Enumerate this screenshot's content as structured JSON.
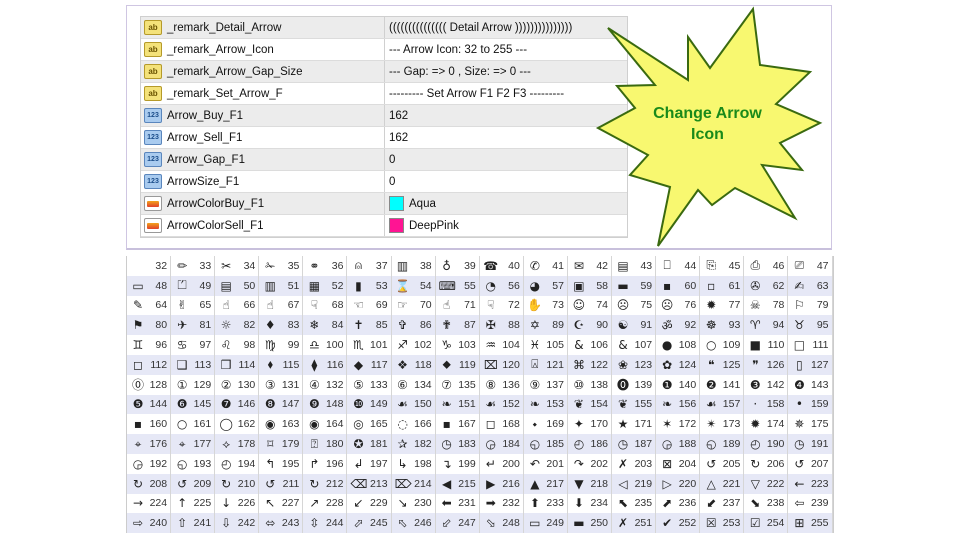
{
  "properties": [
    {
      "type": "string",
      "icon": "ab-icon",
      "name": "_remark_Detail_Arrow",
      "value": "((((((((((((((( Detail Arrow )))))))))))))))"
    },
    {
      "type": "string",
      "icon": "ab-icon",
      "name": "_remark_Arrow_Icon",
      "value": "--- Arrow Icon: 32 to 255 ---"
    },
    {
      "type": "string",
      "icon": "ab-icon",
      "name": "_remark_Arrow_Gap_Size",
      "value": "--- Gap: => 0 , Size: => 0 ---"
    },
    {
      "type": "string",
      "icon": "ab-icon",
      "name": "_remark_Set_Arrow_F",
      "value": "--------- Set Arrow F1 F2 F3 ---------"
    },
    {
      "type": "int",
      "icon": "123-icon",
      "name": "Arrow_Buy_F1",
      "value": "162"
    },
    {
      "type": "int",
      "icon": "123-icon",
      "name": "Arrow_Sell_F1",
      "value": "162"
    },
    {
      "type": "int",
      "icon": "123-icon",
      "name": "Arrow_Gap_F1",
      "value": "0"
    },
    {
      "type": "int",
      "icon": "123-icon",
      "name": "ArrowSize_F1",
      "value": "0"
    },
    {
      "type": "color",
      "icon": "color-icon",
      "name": "ArrowColorBuy_F1",
      "value": "Aqua",
      "swatch": "#00FFFF"
    },
    {
      "type": "color",
      "icon": "color-icon",
      "name": "ArrowColorSell_F1",
      "value": "DeepPink",
      "swatch": "#FF1493"
    }
  ],
  "callout": {
    "line1": "Change Arrow",
    "line2": "Icon",
    "fill": "#f8f870",
    "stroke": "#3a6a10",
    "text_color": "#1a8a1a"
  },
  "icon_table": [
    {
      "codes": [
        32,
        33,
        34,
        35,
        36,
        37,
        38,
        39,
        40,
        41,
        42,
        43,
        44,
        45,
        46,
        47
      ],
      "glyphs": [
        " ",
        "✏",
        "✂",
        "✁",
        "⚭",
        "⍝",
        "▥",
        "♁",
        "☎",
        "✆",
        "✉",
        "▤",
        "⎕",
        "⎘",
        "⎙",
        "⎚"
      ]
    },
    {
      "codes": [
        48,
        49,
        50,
        51,
        52,
        53,
        54,
        55,
        56,
        57,
        58,
        59,
        60,
        61,
        62,
        63
      ],
      "glyphs": [
        "▭",
        "⏍",
        "▤",
        "▥",
        "▦",
        "▮",
        "⌛",
        "⌨",
        "◔",
        "◕",
        "▣",
        "▬",
        "▪",
        "▫",
        "✇",
        "✍"
      ]
    },
    {
      "codes": [
        64,
        65,
        66,
        67,
        68,
        69,
        70,
        71,
        72,
        73,
        74,
        75,
        76,
        77,
        78,
        79
      ],
      "glyphs": [
        "✎",
        "✌",
        "☝",
        "☝",
        "☟",
        "☜",
        "☞",
        "☝",
        "☟",
        "✋",
        "☺",
        "☹",
        "☹",
        "✹",
        "☠",
        "⚐"
      ]
    },
    {
      "codes": [
        80,
        81,
        82,
        83,
        84,
        85,
        86,
        87,
        88,
        89,
        90,
        91,
        92,
        93,
        94,
        95
      ],
      "glyphs": [
        "⚑",
        "✈",
        "☼",
        "♦",
        "❄",
        "✝",
        "✞",
        "✟",
        "✠",
        "✡",
        "☪",
        "☯",
        "ॐ",
        "☸",
        "♈",
        "♉"
      ]
    },
    {
      "codes": [
        96,
        97,
        98,
        99,
        100,
        101,
        102,
        103,
        104,
        105,
        106,
        107,
        108,
        109,
        110,
        111
      ],
      "glyphs": [
        "♊",
        "♋",
        "♌",
        "♍",
        "♎",
        "♏",
        "♐",
        "♑",
        "♒",
        "♓",
        "&",
        "&",
        "●",
        "○",
        "■",
        "□"
      ]
    },
    {
      "codes": [
        112,
        113,
        114,
        115,
        116,
        117,
        118,
        119,
        120,
        121,
        122,
        123,
        124,
        125,
        126,
        127
      ],
      "glyphs": [
        "◻",
        "❑",
        "❒",
        "⬧",
        "⧫",
        "◆",
        "❖",
        "⬥",
        "⌧",
        "⍓",
        "⌘",
        "❀",
        "✿",
        "❝",
        "❞",
        "▯"
      ]
    },
    {
      "codes": [
        128,
        129,
        130,
        131,
        132,
        133,
        134,
        135,
        136,
        137,
        138,
        139,
        140,
        141,
        142,
        143
      ],
      "glyphs": [
        "⓪",
        "①",
        "②",
        "③",
        "④",
        "⑤",
        "⑥",
        "⑦",
        "⑧",
        "⑨",
        "⑩",
        "⓿",
        "❶",
        "❷",
        "❸",
        "❹"
      ]
    },
    {
      "codes": [
        144,
        145,
        146,
        147,
        148,
        149,
        150,
        151,
        152,
        153,
        154,
        155,
        156,
        157,
        158,
        159
      ],
      "glyphs": [
        "❺",
        "❻",
        "❼",
        "❽",
        "❾",
        "❿",
        "☙",
        "❧",
        "☙",
        "❧",
        "❦",
        "❦",
        "❧",
        "☙",
        "·",
        "•"
      ]
    },
    {
      "codes": [
        160,
        161,
        162,
        163,
        164,
        165,
        166,
        167,
        168,
        169,
        170,
        171,
        172,
        173,
        174,
        175
      ],
      "glyphs": [
        "▪",
        "○",
        "◯",
        "◉",
        "◉",
        "◎",
        "◌",
        "▪",
        "◻",
        "⬩",
        "✦",
        "★",
        "✶",
        "✴",
        "✹",
        "✵"
      ]
    },
    {
      "codes": [
        176,
        177,
        178,
        179,
        180,
        181,
        182,
        183,
        184,
        185,
        186,
        187,
        188,
        189,
        190,
        191
      ],
      "glyphs": [
        "⌖",
        "⌖",
        "⟡",
        "⌑",
        "⍰",
        "✪",
        "✰",
        "◷",
        "◶",
        "◵",
        "◴",
        "◷",
        "◶",
        "◵",
        "◴",
        "◷"
      ]
    },
    {
      "codes": [
        192,
        193,
        194,
        195,
        196,
        197,
        198,
        199,
        200,
        201,
        202,
        203,
        204,
        205,
        206,
        207
      ],
      "glyphs": [
        "◶",
        "◵",
        "◴",
        "↰",
        "↱",
        "↲",
        "↳",
        "↴",
        "↵",
        "↶",
        "↷",
        "✗",
        "⊠",
        "↺",
        "↻",
        "↺"
      ]
    },
    {
      "codes": [
        208,
        209,
        210,
        211,
        212,
        213,
        214,
        215,
        216,
        217,
        218,
        219,
        220,
        221,
        222,
        223
      ],
      "glyphs": [
        "↻",
        "↺",
        "↻",
        "↺",
        "↻",
        "⌫",
        "⌦",
        "◀",
        "▶",
        "▲",
        "▼",
        "◁",
        "▷",
        "△",
        "▽",
        "←"
      ]
    },
    {
      "codes": [
        224,
        225,
        226,
        227,
        228,
        229,
        230,
        231,
        232,
        233,
        234,
        235,
        236,
        237,
        238,
        239
      ],
      "glyphs": [
        "→",
        "↑",
        "↓",
        "↖",
        "↗",
        "↙",
        "↘",
        "⬅",
        "➡",
        "⬆",
        "⬇",
        "⬉",
        "⬈",
        "⬋",
        "⬊",
        "⇦"
      ]
    },
    {
      "codes": [
        240,
        241,
        242,
        243,
        244,
        245,
        246,
        247,
        248,
        249,
        250,
        251,
        252,
        253,
        254,
        255
      ],
      "glyphs": [
        "⇨",
        "⇧",
        "⇩",
        "⬄",
        "⇳",
        "⬀",
        "⬁",
        "⬃",
        "⬂",
        "▭",
        "▬",
        "✗",
        "✔",
        "☒",
        "☑",
        "⊞"
      ]
    }
  ]
}
